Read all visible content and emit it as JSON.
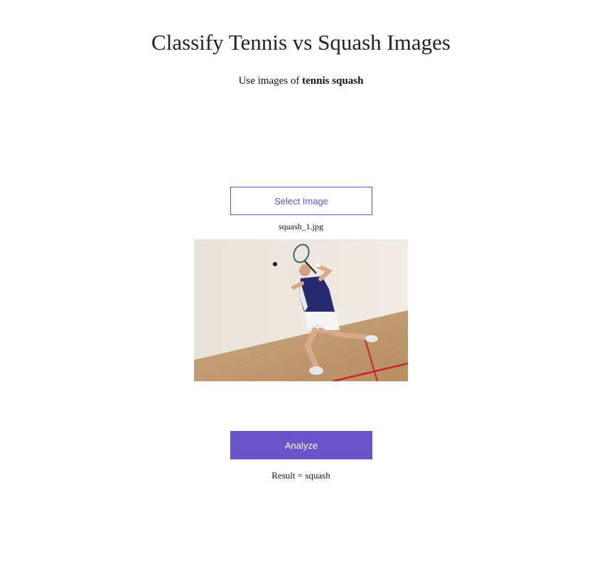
{
  "header": {
    "title": "Classify Tennis vs Squash Images",
    "subtitle_prefix": "Use images of ",
    "subtitle_bold": "tennis squash"
  },
  "upload": {
    "select_label": "Select Image",
    "filename": "squash_1.jpg"
  },
  "preview": {
    "alt": "squash player photo"
  },
  "actions": {
    "analyze_label": "Analyze"
  },
  "result": {
    "text": "Result = squash"
  },
  "colors": {
    "accent": "#6a52c8",
    "court_line": "#c4262b",
    "floor": "#c9a47c",
    "wall": "#ebe4da"
  }
}
